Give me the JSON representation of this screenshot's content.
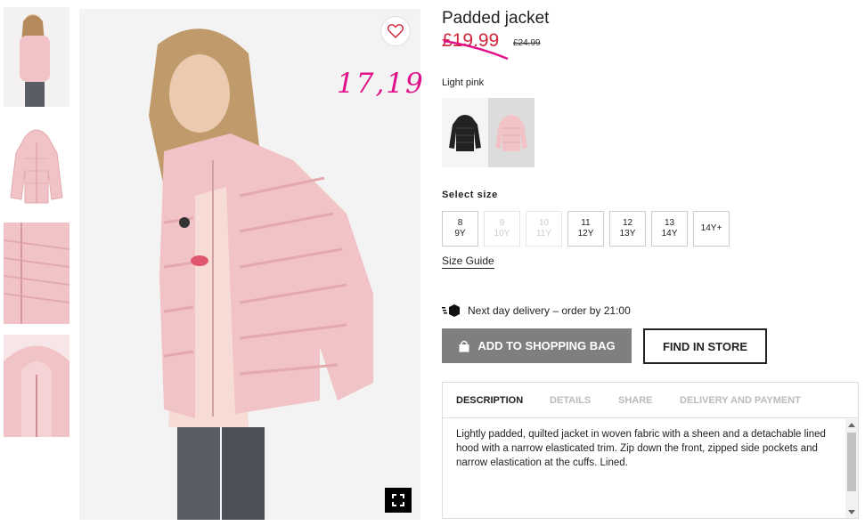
{
  "product": {
    "title": "Padded jacket",
    "price": "£19.99",
    "old_price": "£24.99",
    "color_label": "Light pink",
    "colors": [
      {
        "name": "Black",
        "hex": "#222222"
      },
      {
        "name": "Light pink",
        "hex": "#f2c3c6"
      }
    ]
  },
  "annotation": {
    "handwritten_price": "17,19",
    "color": "#e0108a"
  },
  "sizes": {
    "label": "Select size",
    "options": [
      {
        "line1": "8",
        "line2": "9Y",
        "available": true
      },
      {
        "line1": "9",
        "line2": "10Y",
        "available": false
      },
      {
        "line1": "10",
        "line2": "11Y",
        "available": false
      },
      {
        "line1": "11",
        "line2": "12Y",
        "available": true
      },
      {
        "line1": "12",
        "line2": "13Y",
        "available": true
      },
      {
        "line1": "13",
        "line2": "14Y",
        "available": true
      },
      {
        "line1": "14Y+",
        "line2": "",
        "available": true
      }
    ],
    "guide": "Size Guide"
  },
  "delivery": {
    "text": "Next day delivery – order by 21:00",
    "icon": "delivery-truck-icon"
  },
  "actions": {
    "add_to_bag": "ADD TO SHOPPING BAG",
    "find_in_store": "FIND IN STORE"
  },
  "tabs": [
    {
      "label": "DESCRIPTION",
      "active": true
    },
    {
      "label": "DETAILS",
      "active": false
    },
    {
      "label": "SHARE",
      "active": false
    },
    {
      "label": "DELIVERY AND PAYMENT",
      "active": false
    }
  ],
  "description": "Lightly padded, quilted jacket in woven fabric with a sheen and a detachable lined hood with a narrow elasticated trim. Zip down the front, zipped side pockets and narrow elastication at the cuffs. Lined.",
  "colors": {
    "sale_red": "#d0253a",
    "button_grey": "#7f7f7f",
    "jacket_pink": "#f2c3c6"
  }
}
